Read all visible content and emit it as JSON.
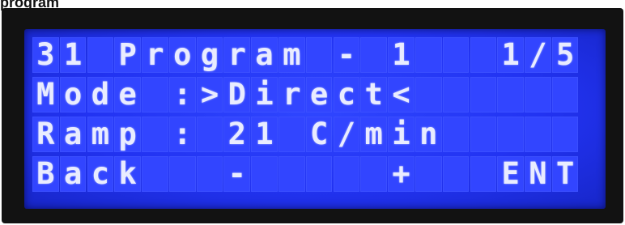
{
  "top_text": "program",
  "lcd": {
    "rows": [
      "31 Program - 1   1/5",
      "Mode :>Direct<      ",
      "Ramp : 21 C/min     ",
      "Back   -     +   ENT"
    ]
  },
  "colors": {
    "panel_blue": "#2233f2",
    "cell_blue": "#3245ff",
    "character_white": "#e9ecff",
    "bezel_black": "#121212"
  }
}
